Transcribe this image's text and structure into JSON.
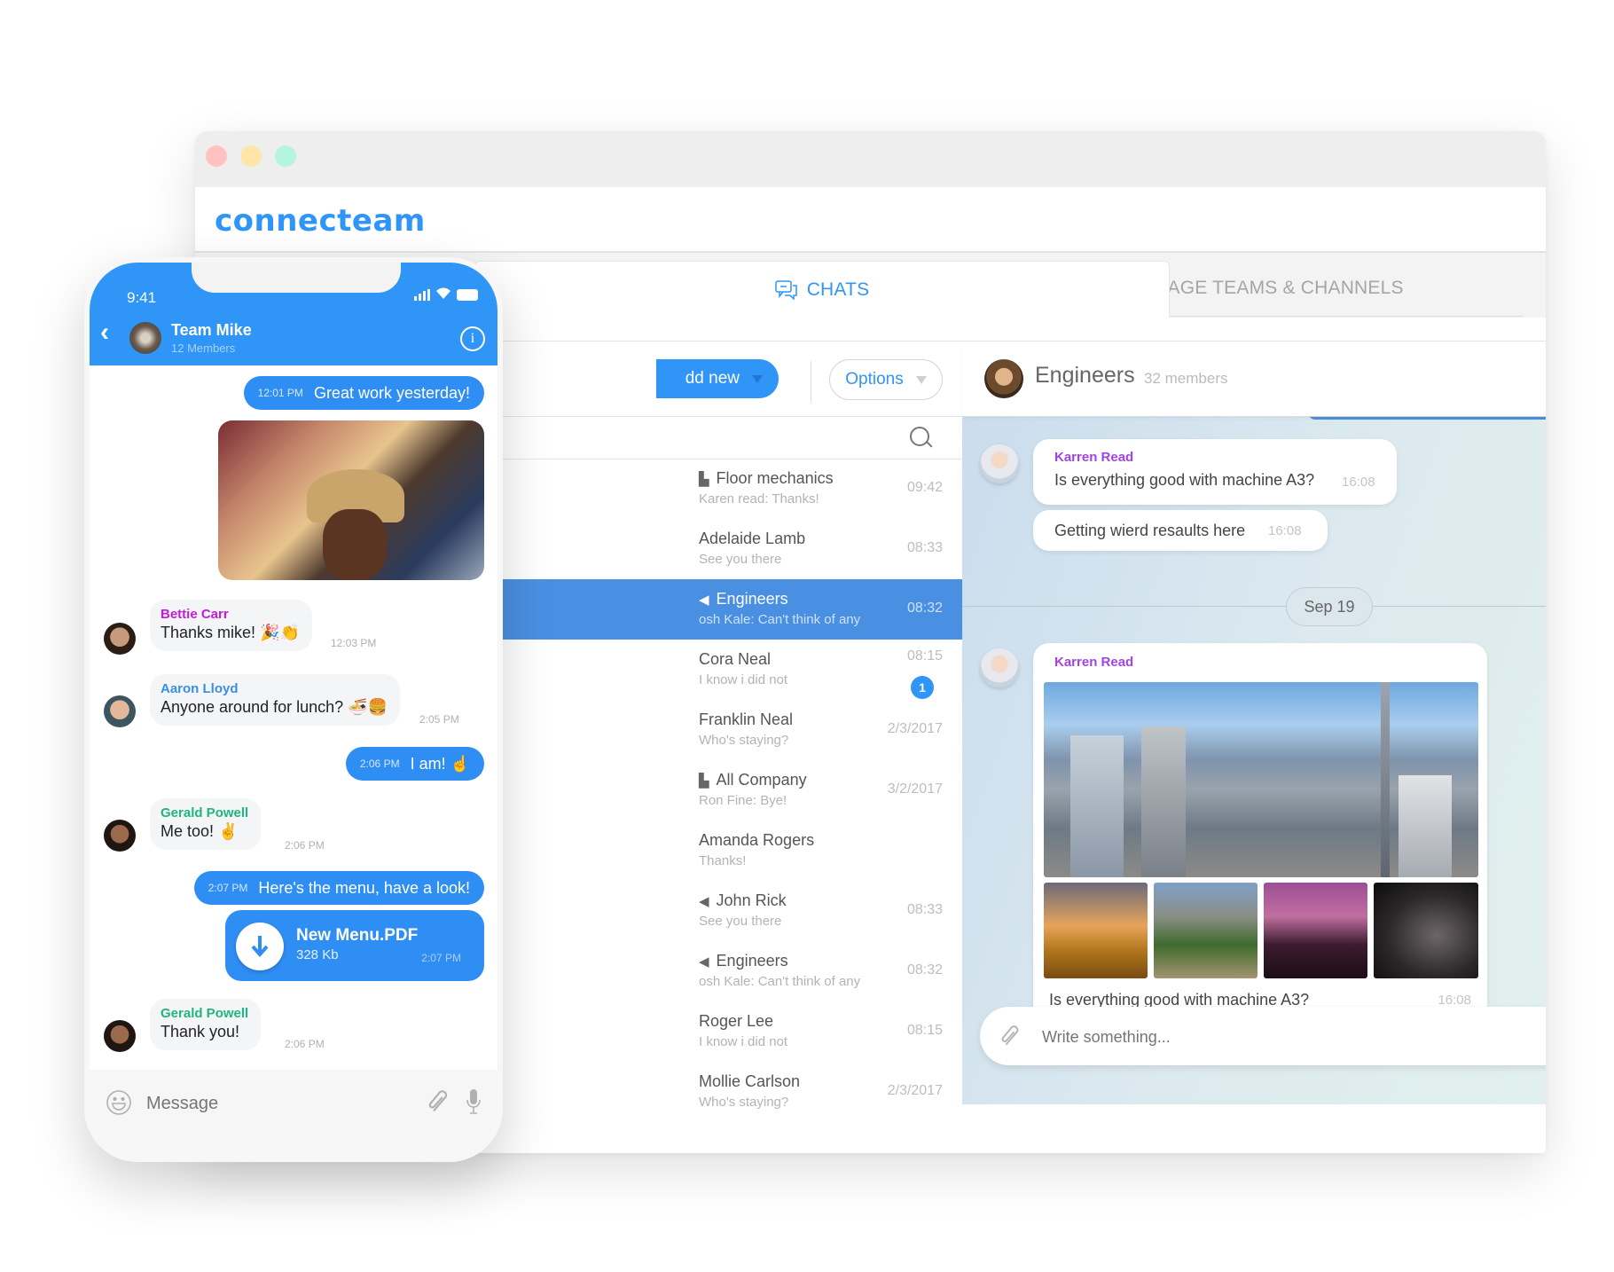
{
  "window": {
    "logo": "connecteam",
    "controls": {
      "close_color": "#ffc2c0",
      "minimize_color": "#ffe6a8",
      "maximize_color": "#b4f5e2"
    }
  },
  "tabs": [
    {
      "label": "CHATS",
      "icon": "chat-bubbles-icon",
      "active": true
    },
    {
      "label": "MANAGE TEAMS & CHANNELS",
      "icon": "team-users-icon",
      "active": false
    }
  ],
  "list_toolbar": {
    "add_new_label": "dd new",
    "options_label": "Options"
  },
  "chat_list": [
    {
      "icon": "group-icon",
      "name": "Floor mechanics",
      "preview": "Karen read: Thanks!",
      "time": "09:42"
    },
    {
      "icon": "",
      "name": "Adelaide Lamb",
      "preview": "See you there",
      "time": "08:33"
    },
    {
      "icon": "megaphone-icon",
      "name": "Engineers",
      "preview": "osh Kale: Can't think of any",
      "time": "08:32",
      "active": true
    },
    {
      "icon": "",
      "name": "Cora Neal",
      "preview": "I know i did not",
      "time": "08:15",
      "unread": "1"
    },
    {
      "icon": "",
      "name": "Franklin Neal",
      "preview": "Who's staying?",
      "time": "2/3/2017"
    },
    {
      "icon": "group-icon",
      "name": "All Company",
      "preview": "Ron Fine: Bye!",
      "time": "3/2/2017"
    },
    {
      "icon": "",
      "name": "Amanda Rogers",
      "preview": "Thanks!",
      "time": ""
    },
    {
      "icon": "megaphone-icon",
      "name": "John Rick",
      "preview": "See you there",
      "time": "08:33"
    },
    {
      "icon": "megaphone-icon",
      "name": "Engineers",
      "preview": "osh Kale: Can't think of any",
      "time": "08:32"
    },
    {
      "icon": "",
      "name": "Roger Lee",
      "preview": "I know i did not",
      "time": "08:15"
    },
    {
      "icon": "",
      "name": "Mollie Carlson",
      "preview": "Who's staying?",
      "time": "2/3/2017"
    }
  ],
  "chat": {
    "group_name": "Engineers",
    "members": "32 members",
    "messages": [
      {
        "sender": "Karren Read",
        "text": "Is everything good with machine A3?",
        "time": "16:08"
      },
      {
        "text": "Getting wierd resaults here",
        "time": "16:08"
      }
    ],
    "date_divider": "Sep 19",
    "media_message": {
      "sender": "Karren Read",
      "caption": "Is everything good with machine A3?",
      "time": "16:08",
      "image_count": 5
    },
    "composer_placeholder": "Write something..."
  },
  "phone": {
    "clock": "9:41",
    "title": "Team Mike",
    "subtitle": "12 Members",
    "messages": [
      {
        "type": "out",
        "time": "12:01 PM",
        "text": "Great work yesterday!"
      },
      {
        "type": "in",
        "sender": "Bettie Carr",
        "sender_color": "#c61ad9",
        "text": "Thanks mike! 🎉👏",
        "time": "12:03 PM"
      },
      {
        "type": "in",
        "sender": "Aaron Lloyd",
        "sender_color": "#3a8ee6",
        "text": "Anyone around for lunch? 🍜🍔",
        "time": "2:05 PM"
      },
      {
        "type": "out",
        "time": "2:06 PM",
        "text": "I am! ☝️"
      },
      {
        "type": "in",
        "sender": "Gerald Powell",
        "sender_color": "#1fb57f",
        "text": "Me too! ✌️",
        "time": "2:06 PM"
      },
      {
        "type": "out",
        "time": "2:07 PM",
        "text": "Here's the menu, have a look!"
      },
      {
        "type": "in",
        "sender": "Gerald Powell",
        "sender_color": "#1fb57f",
        "text": "Thank you!",
        "time": "2:06 PM"
      }
    ],
    "file": {
      "name": "New Menu.PDF",
      "size": "328 Kb",
      "time": "2:07 PM"
    },
    "composer_placeholder": "Message"
  },
  "colors": {
    "brand": "#2f95f6",
    "active_row": "#4a90e2",
    "sender_purple": "#a243e8"
  }
}
